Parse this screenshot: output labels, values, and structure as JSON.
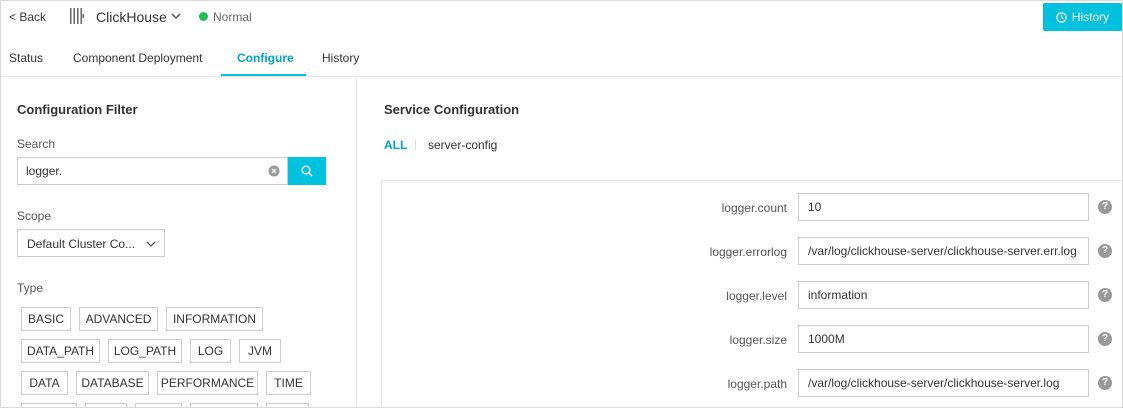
{
  "header": {
    "back_label": "< Back",
    "service_name": "ClickHouse",
    "status_text": "Normal",
    "history_button_label": "History"
  },
  "tabs": [
    {
      "label": "Status"
    },
    {
      "label": "Component Deployment"
    },
    {
      "label": "Configure",
      "active": true
    },
    {
      "label": "History"
    }
  ],
  "filter": {
    "title": "Configuration Filter",
    "search_label": "Search",
    "search_value": "logger.",
    "scope_label": "Scope",
    "scope_value": "Default Cluster Co...",
    "type_label": "Type",
    "type_tags": [
      "BASIC",
      "ADVANCED",
      "INFORMATION",
      "DATA_PATH",
      "LOG_PATH",
      "LOG",
      "JVM",
      "DATA",
      "DATABASE",
      "PERFORMANCE",
      "TIME"
    ]
  },
  "service_config": {
    "title": "Service Configuration",
    "filter_all": "ALL",
    "filter_server": "server-config",
    "items": [
      {
        "key": "logger.count",
        "value": "10"
      },
      {
        "key": "logger.errorlog",
        "value": "/var/log/clickhouse-server/clickhouse-server.err.log"
      },
      {
        "key": "logger.level",
        "value": "information"
      },
      {
        "key": "logger.size",
        "value": "1000M"
      },
      {
        "key": "logger.path",
        "value": "/var/log/clickhouse-server/clickhouse-server.log"
      }
    ]
  },
  "colors": {
    "accent": "#00c1de",
    "accent_text": "#00a3c6",
    "status_ok": "#1fbf5a"
  },
  "icons": {
    "service": "clickhouse-bars-icon",
    "history": "clock-icon",
    "search": "search-icon",
    "clear": "clear-icon",
    "help": "question-icon"
  }
}
